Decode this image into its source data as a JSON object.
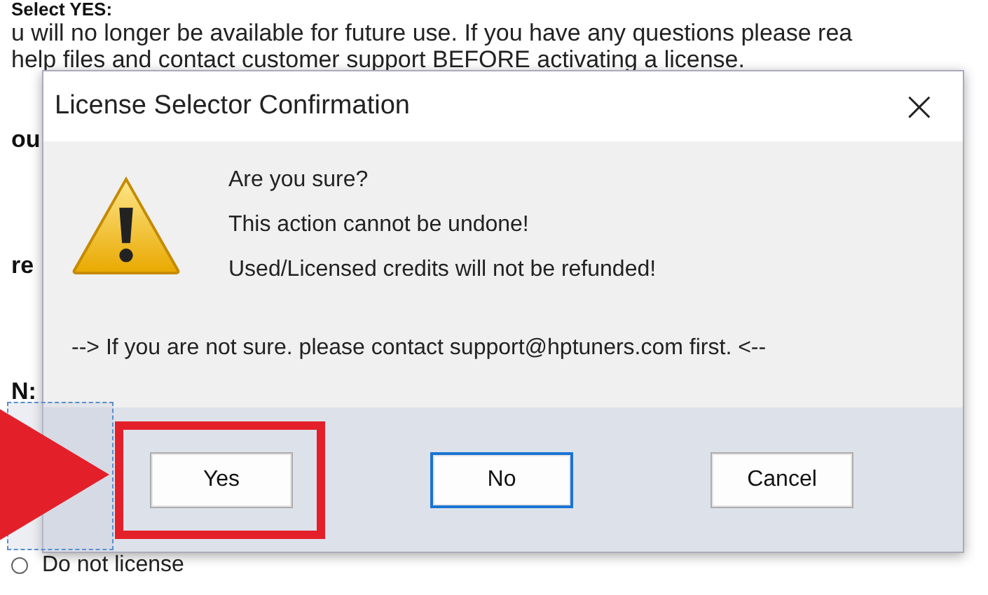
{
  "page": {
    "heading": "Select YES:",
    "lines": [
      "u will no longer be available for future use. If you have any questions please rea",
      "help files and contact customer support BEFORE activating a license."
    ],
    "fragments": [
      {
        "text": "ou",
        "kind": "bold"
      },
      {
        "text": "re",
        "kind": "bold"
      },
      {
        "text": "N:",
        "kind": "bold"
      },
      {
        "text": "Do not license",
        "kind": "radio",
        "selected": false
      }
    ]
  },
  "dialog": {
    "title": "License Selector Confirmation",
    "close": "×",
    "messages": [
      "Are you sure?",
      "This action cannot be undone!",
      "Used/Licensed credits will not be refunded!"
    ],
    "note": "--> If you are not sure. please contact support@hptuners.com first. <--",
    "buttons": [
      {
        "label": "Yes",
        "focused": false,
        "highlighted": true
      },
      {
        "label": "No",
        "focused": true,
        "highlighted": false
      },
      {
        "label": "Cancel",
        "focused": false,
        "highlighted": false
      }
    ]
  }
}
